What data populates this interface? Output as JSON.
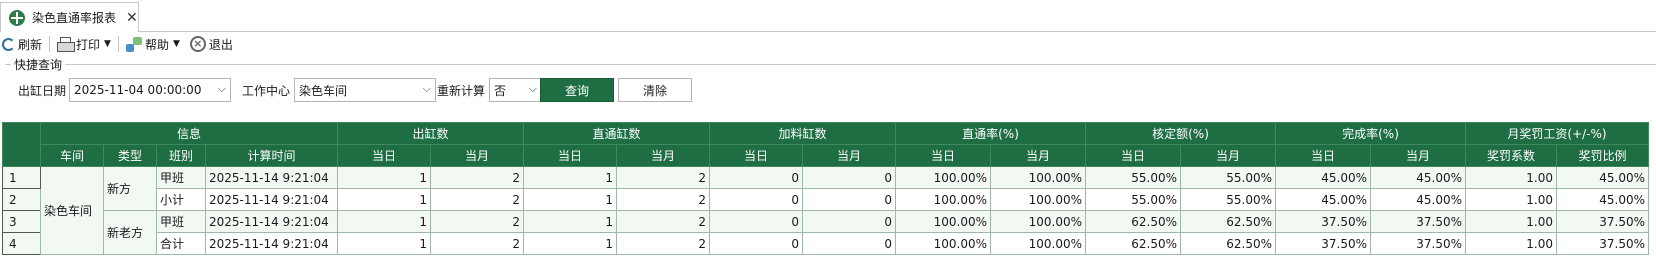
{
  "tab": {
    "title": "染色直通率报表",
    "close": "✕"
  },
  "toolbar": {
    "refresh": "刷新",
    "print": "打印",
    "help": "帮助",
    "exit": "退出"
  },
  "query": {
    "group_title": "快捷查询",
    "date_label": "出缸日期",
    "date_value": "2025-11-04 00:00:00",
    "workcenter_label": "工作中心",
    "workcenter_value": "染色车间",
    "recalc_label": "重新计算",
    "recalc_value": "否",
    "query_button": "查询",
    "clear_button": "清除"
  },
  "grid": {
    "groups": [
      "信息",
      "出缸数",
      "直通缸数",
      "加料缸数",
      "直通率(%)",
      "核定额(%)",
      "完成率(%)",
      "月奖罚工资(+/-%)"
    ],
    "columns": [
      "车间",
      "类型",
      "班别",
      "计算时间",
      "当日",
      "当月",
      "当日",
      "当月",
      "当日",
      "当月",
      "当日",
      "当月",
      "当日",
      "当月",
      "当日",
      "当月",
      "奖罚系数",
      "奖罚比例"
    ],
    "workshop": "染色车间",
    "types": [
      "新方",
      "新老方"
    ],
    "rows": [
      {
        "n": "1",
        "shift": "甲班",
        "time": "2025-11-14 9:21:04",
        "v": [
          "1",
          "2",
          "1",
          "2",
          "0",
          "0",
          "100.00%",
          "100.00%",
          "55.00%",
          "55.00%",
          "45.00%",
          "45.00%",
          "1.00",
          "45.00%"
        ]
      },
      {
        "n": "2",
        "shift": "小计",
        "time": "2025-11-14 9:21:04",
        "v": [
          "1",
          "2",
          "1",
          "2",
          "0",
          "0",
          "100.00%",
          "100.00%",
          "55.00%",
          "55.00%",
          "45.00%",
          "45.00%",
          "1.00",
          "45.00%"
        ]
      },
      {
        "n": "3",
        "shift": "甲班",
        "time": "2025-11-14 9:21:04",
        "v": [
          "1",
          "2",
          "1",
          "2",
          "0",
          "0",
          "100.00%",
          "100.00%",
          "62.50%",
          "62.50%",
          "37.50%",
          "37.50%",
          "1.00",
          "37.50%"
        ]
      },
      {
        "n": "4",
        "shift": "合计",
        "time": "2025-11-14 9:21:04",
        "v": [
          "1",
          "2",
          "1",
          "2",
          "0",
          "0",
          "100.00%",
          "100.00%",
          "62.50%",
          "62.50%",
          "37.50%",
          "37.50%",
          "1.00",
          "37.50%"
        ]
      }
    ]
  }
}
